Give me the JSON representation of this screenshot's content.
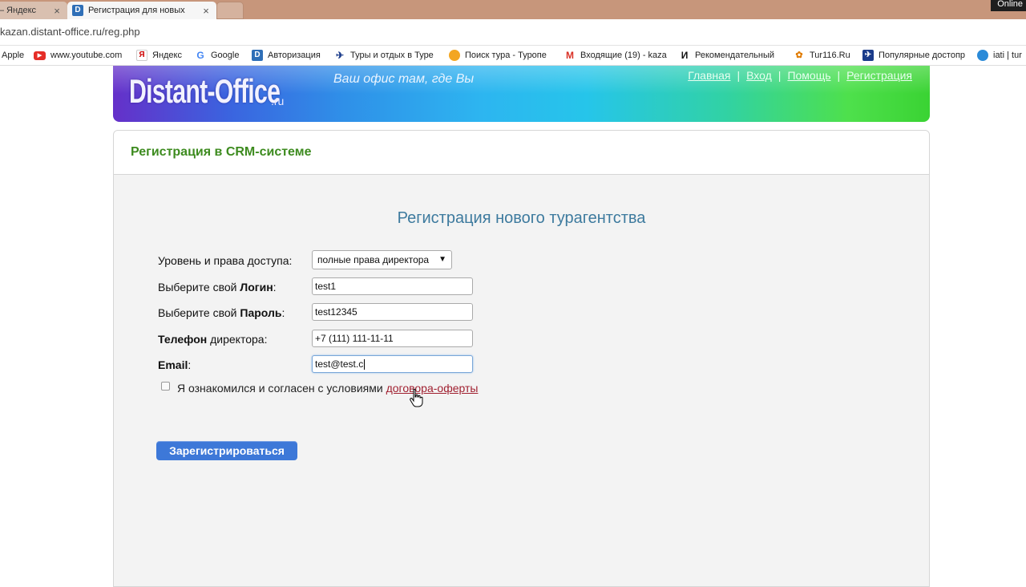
{
  "browser": {
    "tabs": [
      {
        "title": "— Яндекс"
      },
      {
        "title": "Регистрация для новых"
      },
      {
        "title": ""
      }
    ],
    "online_label": "Online",
    "url": "kazan.distant-office.ru/reg.php",
    "bookmarks": [
      {
        "label": "Apple",
        "icon": "apple-icon"
      },
      {
        "label": "www.youtube.com",
        "icon": "youtube-icon",
        "color": "#e52d27"
      },
      {
        "label": "Яндекс",
        "icon": "yandex-icon",
        "color": "#cc0000"
      },
      {
        "label": "Google",
        "icon": "google-icon"
      },
      {
        "label": "Авторизация",
        "icon": "distant-office-icon",
        "color": "#2f6fb7"
      },
      {
        "label": "Туры и отдых в Туре",
        "icon": "bird-icon"
      },
      {
        "label": "Поиск тура - Туропе",
        "icon": "globe-icon"
      },
      {
        "label": "Входящие (19) - kaza",
        "icon": "gmail-icon"
      },
      {
        "label": "Рекомендательный",
        "icon": "i-icon"
      },
      {
        "label": "Tur116.Ru",
        "icon": "tur116-icon"
      },
      {
        "label": "Популярные достопр",
        "icon": "popular-icon"
      },
      {
        "label": "iati | tur",
        "icon": "iati-icon"
      }
    ]
  },
  "site": {
    "logo": "Distant-Office",
    "logo_suffix": ".ru",
    "slogan": "Ваш офис там, где Вы",
    "nav": [
      "Главная",
      "Вход",
      "Помощь",
      "Регистрация"
    ]
  },
  "panel": {
    "title": "Регистрация в CRM-системе"
  },
  "form": {
    "title": "Регистрация нового турагентства",
    "access_label": "Уровень и права доступа:",
    "access_value": "полные права директора",
    "login_label_pre": "Выберите свой ",
    "login_label_bold": "Логин",
    "login_label_post": ":",
    "login_value": "test1",
    "password_label_pre": "Выберите свой ",
    "password_label_bold": "Пароль",
    "password_label_post": ":",
    "password_value": "test12345",
    "phone_label_bold": "Телефон",
    "phone_label_post": " директора:",
    "phone_value": "+7 (111) 111-11-11",
    "email_label_bold": "Email",
    "email_label_post": ":",
    "email_value": "test@test.c",
    "agree_text": "Я ознакомился и согласен с условиями ",
    "agree_link": "договора-оферты",
    "agree_checked": false,
    "submit_label": "Зарегистрироваться"
  },
  "colors": {
    "panel_title": "#3d8b1f",
    "form_title": "#3d7a9e",
    "submit": "#3d78d8",
    "link": "#a02030"
  }
}
